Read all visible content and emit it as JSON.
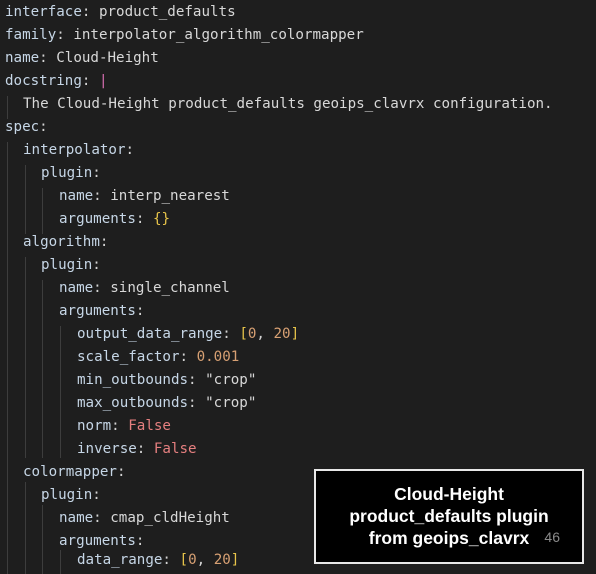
{
  "code": {
    "l1_key": "interface",
    "l1_val": "product_defaults",
    "l2_key": "family",
    "l2_val": "interpolator_algorithm_colormapper",
    "l3_key": "name",
    "l3_val": "Cloud-Height",
    "l4_key": "docstring",
    "l4_pipe": "|",
    "l5_text": "The Cloud-Height product_defaults geoips_clavrx configuration.",
    "l6_key": "spec",
    "l7_key": "interpolator",
    "l8_key": "plugin",
    "l9_key": "name",
    "l9_val": "interp_nearest",
    "l10_key": "arguments",
    "l10_val": "{}",
    "l11_key": "algorithm",
    "l12_key": "plugin",
    "l13_key": "name",
    "l13_val": "single_channel",
    "l14_key": "arguments",
    "l15_key": "output_data_range",
    "l15_open": "[",
    "l15_a": "0",
    "l15_sep": ", ",
    "l15_b": "20",
    "l15_close": "]",
    "l16_key": "scale_factor",
    "l16_val": "0.001",
    "l17_key": "min_outbounds",
    "l17_val": "\"crop\"",
    "l18_key": "max_outbounds",
    "l18_val": "\"crop\"",
    "l19_key": "norm",
    "l19_val": "False",
    "l20_key": "inverse",
    "l20_val": "False",
    "l21_key": "colormapper",
    "l22_key": "plugin",
    "l23_key": "name",
    "l23_val": "cmap_cldHeight",
    "l24_key": "arguments",
    "l25_key": "data_range",
    "l25_open": "[",
    "l25_a": "0",
    "l25_sep": ", ",
    "l25_b": "20",
    "l25_close": "]"
  },
  "caption": {
    "line1": "Cloud-Height",
    "line2": "product_defaults plugin",
    "line3": "from geoips_clavrx"
  },
  "page_number": "46"
}
